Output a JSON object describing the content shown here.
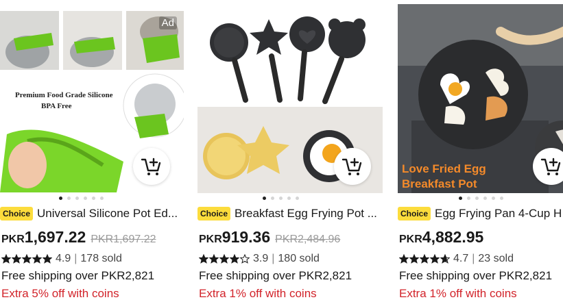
{
  "colors": {
    "choice_bg": "#fcdc3c",
    "coin_text": "#d2232a",
    "star": "#191919"
  },
  "products": [
    {
      "ad_label": "Ad",
      "image_text_1": "Premium Food Grade Silicone",
      "image_text_2": "BPA Free",
      "choice": "Choice",
      "title": "Universal Silicone Pot Ed...",
      "currency": "PKR",
      "price": "1,697.22",
      "old_price": "PKR1,697.22",
      "rating": "4.9",
      "rating_value": 4.9,
      "sold": "178 sold",
      "shipping": "Free shipping over PKR2,821",
      "coins": "Extra 5% off with coins",
      "carousel": {
        "count": 6,
        "active": 0
      }
    },
    {
      "choice": "Choice",
      "title": "Breakfast Egg Frying Pot ...",
      "currency": "PKR",
      "price": "919.36",
      "old_price": "PKR2,484.96",
      "rating": "3.9",
      "rating_value": 3.9,
      "sold": "180 sold",
      "shipping": "Free shipping over PKR2,821",
      "coins": "Extra 1% off with coins",
      "carousel": {
        "count": 5,
        "active": 0
      }
    },
    {
      "image_text_1": "Love Fried Egg",
      "image_text_2": "Breakfast Pot",
      "choice": "Choice",
      "title": "Egg Frying Pan 4-Cup H",
      "currency": "PKR",
      "price": "4,882.95",
      "old_price": "",
      "rating": "4.7",
      "rating_value": 4.7,
      "sold": "23 sold",
      "shipping": "Free shipping over PKR2,821",
      "coins": "Extra 1% off with coins",
      "carousel": {
        "count": 6,
        "active": 0
      }
    }
  ]
}
